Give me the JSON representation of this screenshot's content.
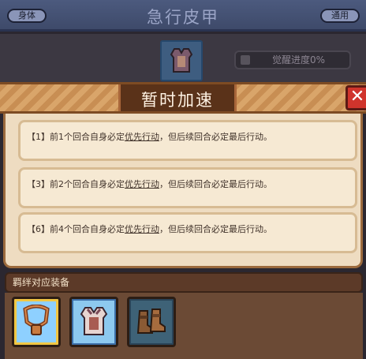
{
  "background": {
    "tag_left": "身体",
    "title": "急行皮甲",
    "tag_right": "通用",
    "progress_label": "觉醒进度0%"
  },
  "popup": {
    "title": "暂时加速",
    "close_label": "✕",
    "entries": [
      {
        "prefix": "【1】前1个回合自身必定",
        "emphasis": "优先行动",
        "suffix": "，但后续回合必定最后行动。"
      },
      {
        "prefix": "【3】前2个回合自身必定",
        "emphasis": "优先行动",
        "suffix": "，但后续回合必定最后行动。"
      },
      {
        "prefix": "【6】前4个回合自身必定",
        "emphasis": "优先行动",
        "suffix": "，但后续回合必定最后行动。"
      }
    ]
  },
  "bond": {
    "label": "羁绊对应装备",
    "items": [
      {
        "icon": "necklace-icon"
      },
      {
        "icon": "leather-armor-icon"
      },
      {
        "icon": "boots-icon"
      }
    ]
  }
}
